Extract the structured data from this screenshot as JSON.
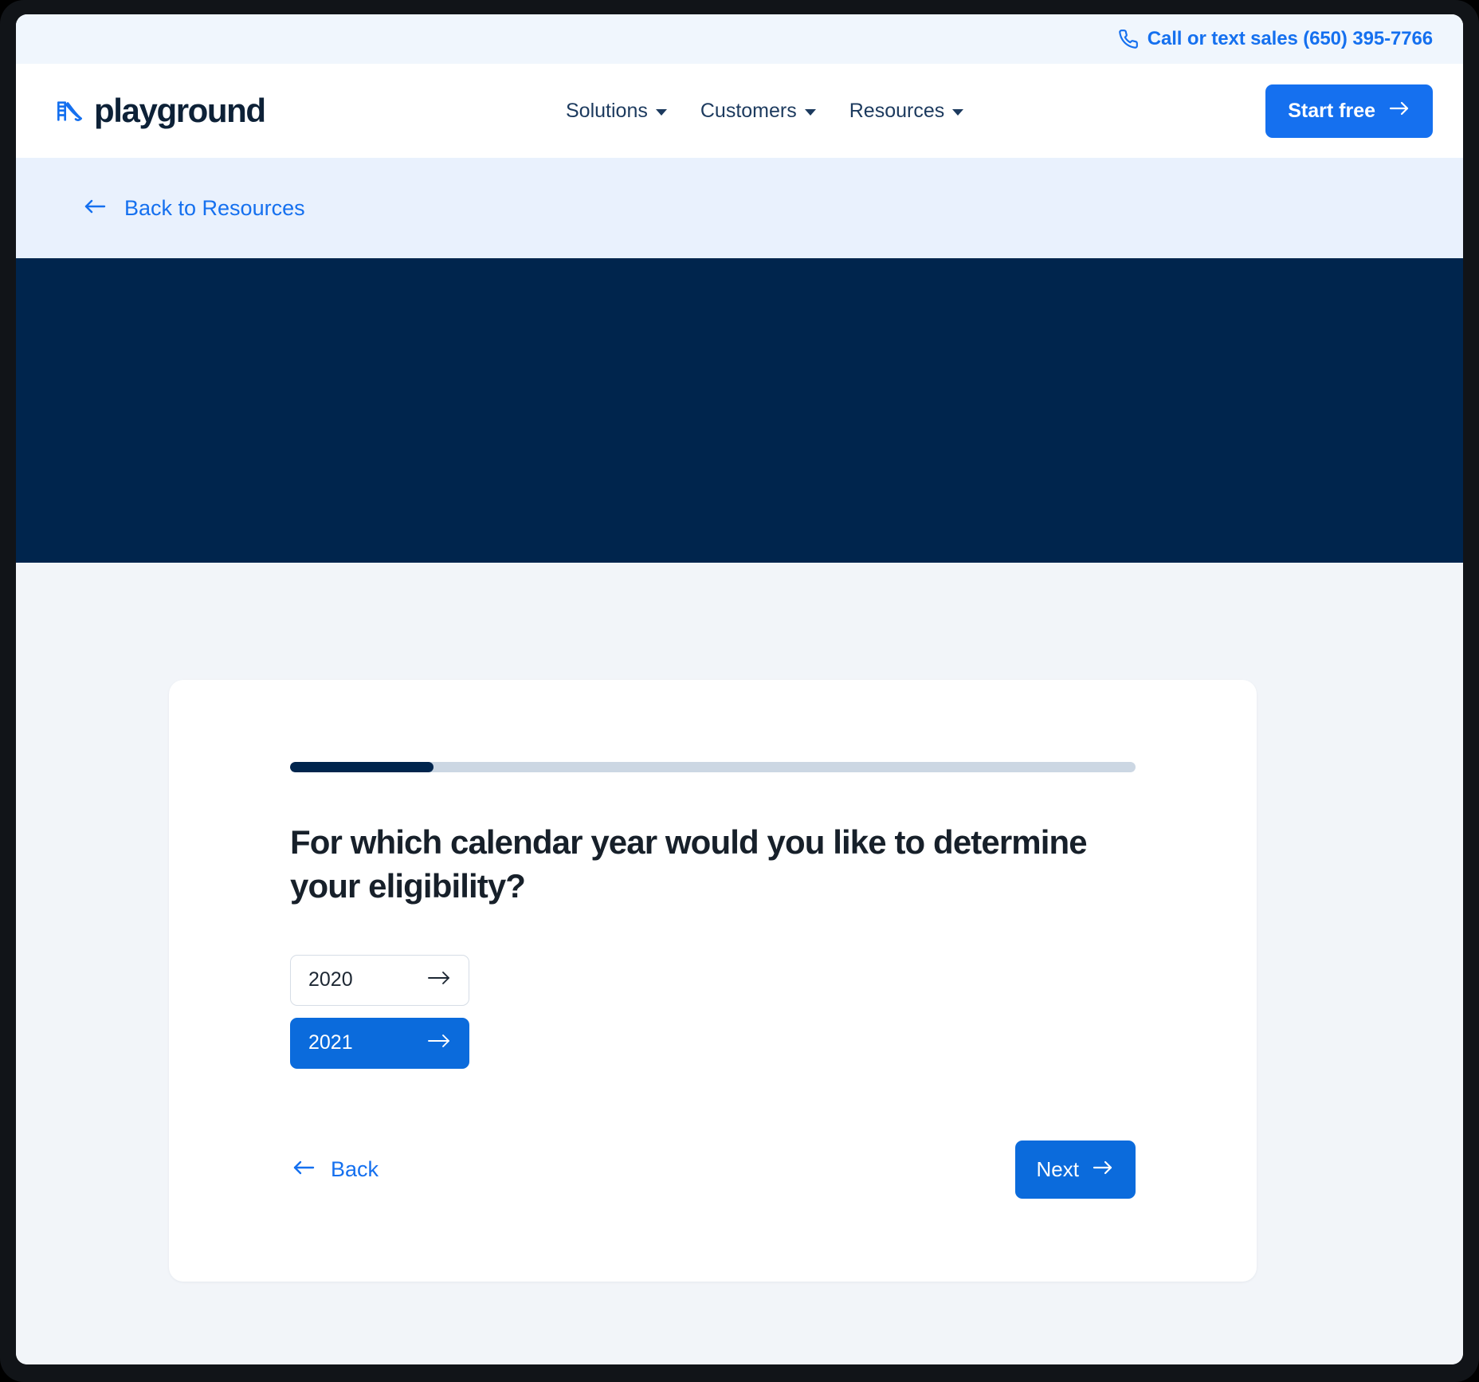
{
  "utility_bar": {
    "phone_icon": "phone-icon",
    "phone_text": "Call or text sales (650) 395-7766"
  },
  "nav": {
    "logo_icon": "playground-slide-icon",
    "brand_name": "playground",
    "items": [
      {
        "label": "Solutions",
        "caret_icon": "chevron-down-icon"
      },
      {
        "label": "Customers",
        "caret_icon": "chevron-down-icon"
      },
      {
        "label": "Resources",
        "caret_icon": "chevron-down-icon"
      }
    ],
    "cta_label": "Start free",
    "cta_icon": "arrow-right-icon"
  },
  "breadcrumb": {
    "back_icon": "arrow-left-icon",
    "label": "Back to Resources"
  },
  "wizard": {
    "progress_percent": 17,
    "question": "For which calendar year would you like to determine your eligibility?",
    "options": [
      {
        "label": "2020",
        "selected": false,
        "arrow_icon": "arrow-right-icon"
      },
      {
        "label": "2021",
        "selected": true,
        "arrow_icon": "arrow-right-icon"
      }
    ],
    "back_label": "Back",
    "back_icon": "arrow-left-icon",
    "next_label": "Next",
    "next_icon": "arrow-right-icon"
  },
  "colors": {
    "accent_blue": "#1570ef",
    "button_blue": "#0b6bdc",
    "navy": "#00254d",
    "page_bg": "#f2f5f9",
    "utility_bg": "#f0f6fd",
    "breadcrumb_bg": "#e9f1fd",
    "progress_track": "#ccd7e3"
  }
}
